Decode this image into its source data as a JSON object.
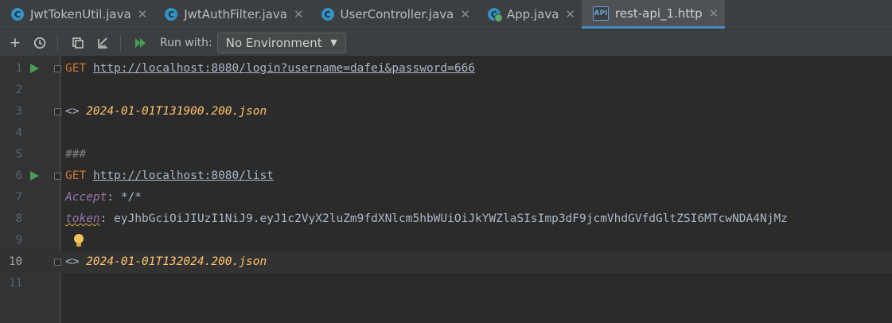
{
  "tabs": [
    {
      "label": "JwtTokenUtil.java",
      "icon": "java-class-icon",
      "active": false
    },
    {
      "label": "JwtAuthFilter.java",
      "icon": "java-class-icon",
      "active": false
    },
    {
      "label": "UserController.java",
      "icon": "java-class-icon",
      "active": false
    },
    {
      "label": "App.java",
      "icon": "java-app-class-icon",
      "active": false
    },
    {
      "label": "rest-api_1.http",
      "icon": "api-http-file-icon",
      "active": true
    }
  ],
  "toolbar": {
    "run_with_label": "Run with:",
    "environment": "No Environment"
  },
  "editor": {
    "current_line": 10,
    "lines": [
      {
        "n": "1",
        "method": "GET",
        "url": "http://localhost:8080/login?username=dafei&password=666"
      },
      {
        "n": "2"
      },
      {
        "n": "3",
        "prefix": "<>",
        "file": "2024-01-01T131900.200.json"
      },
      {
        "n": "4"
      },
      {
        "n": "5",
        "comment": "###"
      },
      {
        "n": "6",
        "method": "GET",
        "url": "http://localhost:8080/list"
      },
      {
        "n": "7",
        "header": "Accept",
        "value": ": */*"
      },
      {
        "n": "8",
        "header": "token",
        "value": ": eyJhbGciOiJIUzI1NiJ9.eyJ1c2VyX2luZm9fdXNlcm5hbWUiOiJkYWZlaSIsImp3dF9jcmVhdGVfdGltZSI6MTcwNDA4NjMz"
      },
      {
        "n": "9"
      },
      {
        "n": "10",
        "prefix": "<>",
        "file": "2024-01-01T132024.200.json"
      },
      {
        "n": "11"
      }
    ]
  },
  "colors": {
    "keyword": "#cc7832",
    "response_file": "#ffc66d",
    "header_name": "#9876aa",
    "run_icon": "#499c54",
    "accent": "#4a88c7"
  }
}
